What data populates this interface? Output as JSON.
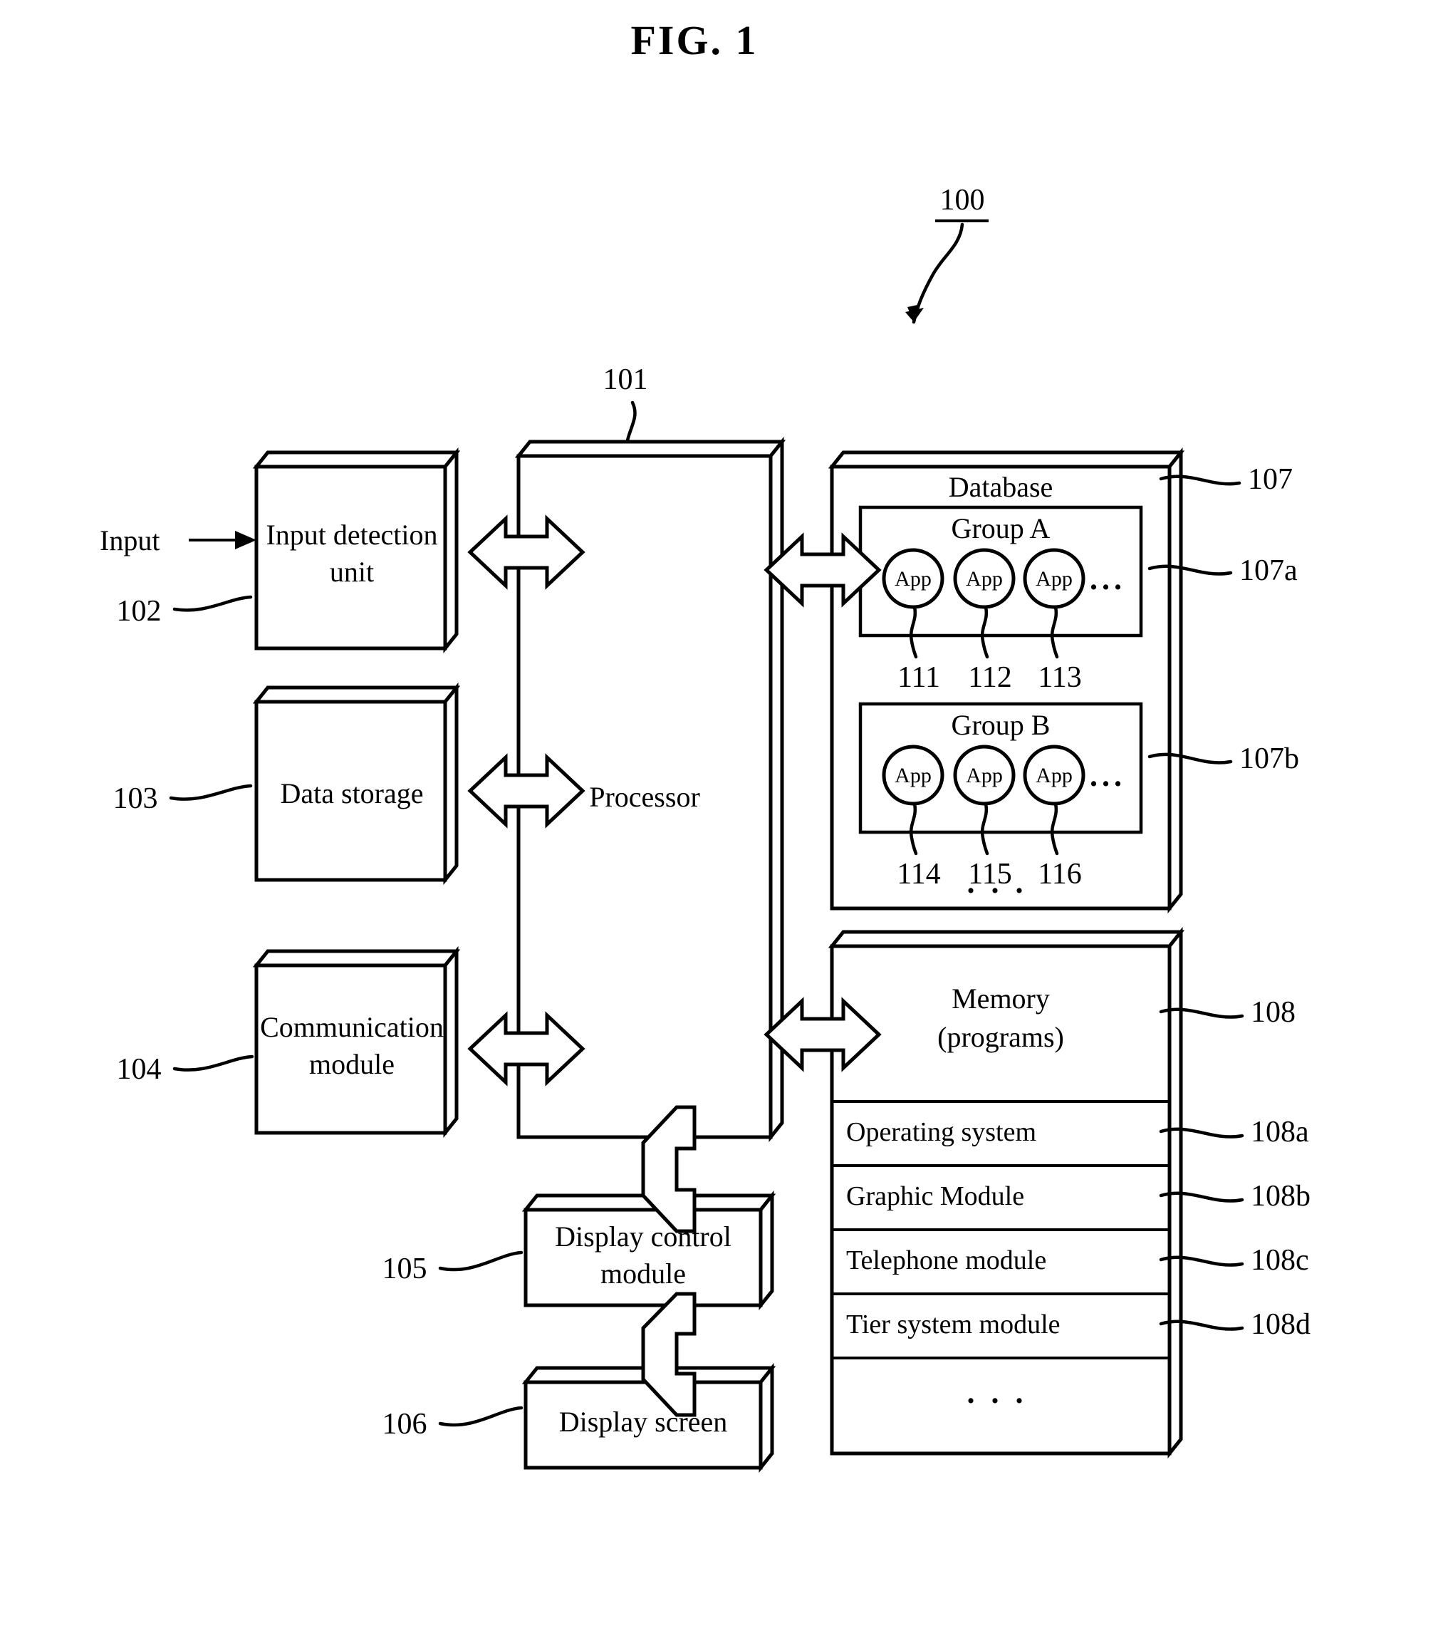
{
  "figure": {
    "title": "FIG. 1",
    "system_ref": "100"
  },
  "blocks": {
    "processor": {
      "label": "Processor",
      "ref": "101"
    },
    "input_detection": {
      "label_line1": "Input detection",
      "label_line2": "unit",
      "ref": "102",
      "input_arrow_label": "Input"
    },
    "data_storage": {
      "label": "Data storage",
      "ref": "103"
    },
    "communication": {
      "label_line1": "Communication",
      "label_line2": "module",
      "ref": "104"
    },
    "display_control": {
      "label_line1": "Display control",
      "label_line2": "module",
      "ref": "105"
    },
    "display_screen": {
      "label": "Display screen",
      "ref": "106"
    }
  },
  "database": {
    "title": "Database",
    "ref": "107",
    "groups": [
      {
        "name": "Group A",
        "ref": "107a",
        "apps": [
          {
            "label": "App",
            "ref": "111"
          },
          {
            "label": "App",
            "ref": "112"
          },
          {
            "label": "App",
            "ref": "113"
          }
        ],
        "ellipsis": "..."
      },
      {
        "name": "Group B",
        "ref": "107b",
        "apps": [
          {
            "label": "App",
            "ref": "114"
          },
          {
            "label": "App",
            "ref": "115"
          },
          {
            "label": "App",
            "ref": "116"
          }
        ],
        "ellipsis": "..."
      }
    ],
    "more_indicator": ". . ."
  },
  "memory": {
    "title_line1": "Memory",
    "title_line2": "(programs)",
    "ref": "108",
    "rows": [
      {
        "label": "Operating system",
        "ref": "108a"
      },
      {
        "label": "Graphic Module",
        "ref": "108b"
      },
      {
        "label": "Telephone module",
        "ref": "108c"
      },
      {
        "label": "Tier system module",
        "ref": "108d"
      }
    ],
    "more_indicator": ". . ."
  },
  "colors": {
    "ink": "#000000",
    "paper": "#ffffff"
  }
}
